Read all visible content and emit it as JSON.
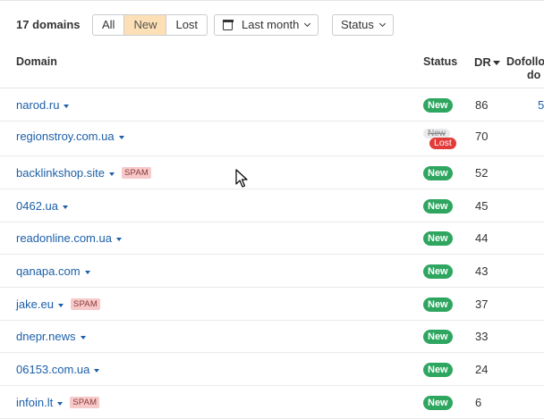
{
  "toolbar": {
    "count": "17 domains",
    "filters": [
      "All",
      "New",
      "Lost"
    ],
    "active_filter": "New",
    "date_label": "Last month",
    "status_label": "Status"
  },
  "table": {
    "columns": {
      "domain": "Domain",
      "status": "Status",
      "dr": "DR",
      "dofollow_line1": "Dofollo",
      "dofollow_line2": "do"
    },
    "rows": [
      {
        "domain": "narod.ru",
        "spam": "",
        "status": "New",
        "dr": "86",
        "dofollow": "5"
      },
      {
        "domain": "regionstroy.com.ua",
        "spam": "",
        "status_old": "New",
        "status": "Lost",
        "dr": "70",
        "dofollow": ""
      },
      {
        "domain": "backlinkshop.site",
        "spam": "SPAM",
        "status": "New",
        "dr": "52",
        "dofollow": ""
      },
      {
        "domain": "0462.ua",
        "spam": "",
        "status": "New",
        "dr": "45",
        "dofollow": ""
      },
      {
        "domain": "readonline.com.ua",
        "spam": "",
        "status": "New",
        "dr": "44",
        "dofollow": ""
      },
      {
        "domain": "qanapa.com",
        "spam": "",
        "status": "New",
        "dr": "43",
        "dofollow": ""
      },
      {
        "domain": "jake.eu",
        "spam": "SPAM",
        "status": "New",
        "dr": "37",
        "dofollow": ""
      },
      {
        "domain": "dnepr.news",
        "spam": "",
        "status": "New",
        "dr": "33",
        "dofollow": ""
      },
      {
        "domain": "06153.com.ua",
        "spam": "",
        "status": "New",
        "dr": "24",
        "dofollow": ""
      },
      {
        "domain": "infoin.lt",
        "spam": "SPAM",
        "status": "New",
        "dr": "6",
        "dofollow": ""
      }
    ]
  },
  "colors": {
    "link": "#1c5fa8",
    "new_badge": "#2ea660",
    "lost_badge": "#e33a3a",
    "spam_badge": "#f7c9c9",
    "active_filter": "#fde0b5"
  },
  "icons": {
    "date_button": "calendar-icon",
    "dropdown": "chevron-down-icon",
    "domain_menu": "caret-down-icon",
    "sort": "sort-desc-icon",
    "pointer": "mouse-cursor-icon"
  }
}
